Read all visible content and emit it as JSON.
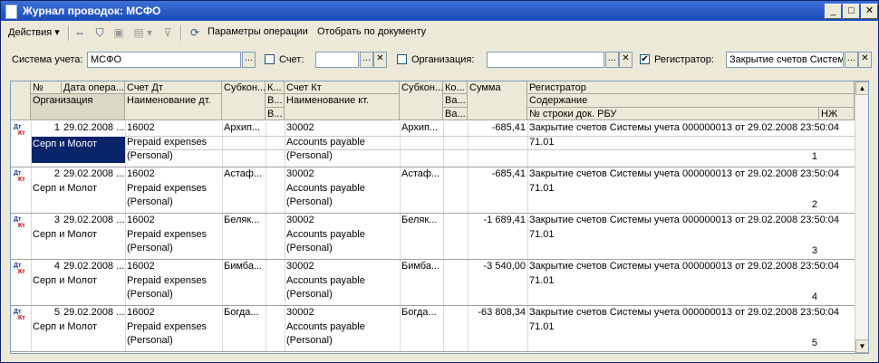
{
  "window": {
    "title": "Журнал проводок: МСФО",
    "controls": [
      "_",
      "□",
      "✕"
    ]
  },
  "toolbar": {
    "actions_label": "Действия",
    "params_label": "Параметры операции",
    "select_by_doc_label": "Отобрать по документу"
  },
  "filters": {
    "accounting_system_label": "Система учета:",
    "accounting_system_value": "МСФО",
    "account_label": "Счет:",
    "account_value": "",
    "organization_label": "Организация:",
    "organization_value": "",
    "registrar_label": "Регистратор:",
    "registrar_value": "Закрытие счетов Систем",
    "registrar_checked": "✔"
  },
  "grid": {
    "headers": {
      "num": "№",
      "date": "Дата опера...",
      "org": "Организация",
      "dt": "Счет Дт",
      "dt_name": "Наименование дт.",
      "subk1": "Субкон...",
      "k1": "К...",
      "b1": "В...",
      "b1b": "В...",
      "kt": "Счет Кт",
      "kt_name": "Наименование кт.",
      "subk2": "Субкон...",
      "k2": "Ко...",
      "b2": "Ва...",
      "b2b": "Ва...",
      "sum": "Сумма",
      "reg": "Регистратор",
      "content": "Содержание",
      "rbu": "№ строки док. РБУ",
      "nzh": "НЖ"
    },
    "icon": {
      "dt": "Дт",
      "kt": "Кт"
    },
    "rows": [
      {
        "num": "1",
        "date": "29.02.2008 ...",
        "org": "Серп и Молот",
        "dt": "16002",
        "dt_name1": "Prepaid expenses",
        "dt_name2": "(Personal)",
        "subk1": "Архип...",
        "kt": "30002",
        "kt_name1": "Accounts payable",
        "kt_name2": "(Personal)",
        "subk2": "Архип...",
        "sum": "-685,41",
        "reg": "Закрытие счетов Системы учета 000000013 от 29.02.2008 23:50:04",
        "content": "71.01",
        "rbu": "1"
      },
      {
        "num": "2",
        "date": "29.02.2008 ...",
        "org": "Серп и Молот",
        "dt": "16002",
        "dt_name1": "Prepaid expenses",
        "dt_name2": "(Personal)",
        "subk1": "Астаф...",
        "kt": "30002",
        "kt_name1": "Accounts payable",
        "kt_name2": "(Personal)",
        "subk2": "Астаф...",
        "sum": "-685,41",
        "reg": "Закрытие счетов Системы учета 000000013 от 29.02.2008 23:50:04",
        "content": "71.01",
        "rbu": "2"
      },
      {
        "num": "3",
        "date": "29.02.2008 ...",
        "org": "Серп и Молот",
        "dt": "16002",
        "dt_name1": "Prepaid expenses",
        "dt_name2": "(Personal)",
        "subk1": "Беляк...",
        "kt": "30002",
        "kt_name1": "Accounts payable",
        "kt_name2": "(Personal)",
        "subk2": "Беляк...",
        "sum": "-1 689,41",
        "reg": "Закрытие счетов Системы учета 000000013 от 29.02.2008 23:50:04",
        "content": "71.01",
        "rbu": "3"
      },
      {
        "num": "4",
        "date": "29.02.2008 ...",
        "org": "Серп и Молот",
        "dt": "16002",
        "dt_name1": "Prepaid expenses",
        "dt_name2": "(Personal)",
        "subk1": "Бимба...",
        "kt": "30002",
        "kt_name1": "Accounts payable",
        "kt_name2": "(Personal)",
        "subk2": "Бимба...",
        "sum": "-3 540,00",
        "reg": "Закрытие счетов Системы учета 000000013 от 29.02.2008 23:50:04",
        "content": "71.01",
        "rbu": "4"
      },
      {
        "num": "5",
        "date": "29.02.2008 ...",
        "org": "Серп и Молот",
        "dt": "16002",
        "dt_name1": "Prepaid expenses",
        "dt_name2": "(Personal)",
        "subk1": "Богда...",
        "kt": "30002",
        "kt_name1": "Accounts payable",
        "kt_name2": "(Personal)",
        "subk2": "Богда...",
        "sum": "-63 808,34",
        "reg": "Закрытие счетов Системы учета 000000013 от 29.02.2008 23:50:04",
        "content": "71.01",
        "rbu": "5"
      }
    ]
  },
  "colors": {
    "titlebar": "#1a4bb8",
    "selection": "#0a246a"
  }
}
